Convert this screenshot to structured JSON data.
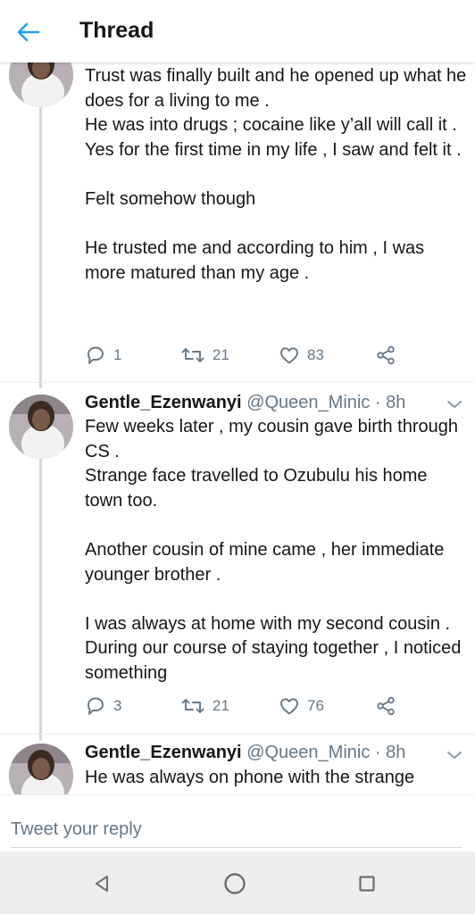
{
  "header": {
    "title": "Thread",
    "back_icon": "arrow-left-icon",
    "accent_color": "#1da1f2"
  },
  "tweets": [
    {
      "text": "Trust was finally built and he opened up what he does for a living to me .\nHe was into drugs ; cocaine like y’all will call it .\nYes for the first time in my life , I saw and felt it .\n\nFelt somehow though\n\nHe trusted me and according to him , I was more matured than my age .",
      "replies": "1",
      "retweets": "21",
      "likes": "83"
    },
    {
      "name": "Gentle_Ezenwanyi",
      "handle": "@Queen_Minic",
      "time": "· 8h",
      "text": "Few weeks later , my cousin gave birth through CS .\nStrange face travelled to Ozubulu his home town too.\n\nAnother cousin of mine came , her immediate younger brother .\n\nI was always at home with my second cousin . During our course of staying together , I noticed something",
      "replies": "3",
      "retweets": "21",
      "likes": "76"
    },
    {
      "name": "Gentle_Ezenwanyi",
      "handle": "@Queen_Minic",
      "time": "· 8h",
      "text": "He was always on phone with the strange"
    }
  ],
  "reply": {
    "placeholder": "Tweet your reply"
  },
  "icons": {
    "reply": "reply-icon",
    "retweet": "retweet-icon",
    "like": "heart-icon",
    "share": "share-icon",
    "caret": "chevron-down-icon",
    "nav_back": "triangle-back-icon",
    "nav_home": "circle-home-icon",
    "nav_recent": "square-recents-icon"
  },
  "colors": {
    "text": "#14171a",
    "secondary": "#657786",
    "thread_line": "#cfd9de",
    "nav_bar": "#eeeeee"
  }
}
